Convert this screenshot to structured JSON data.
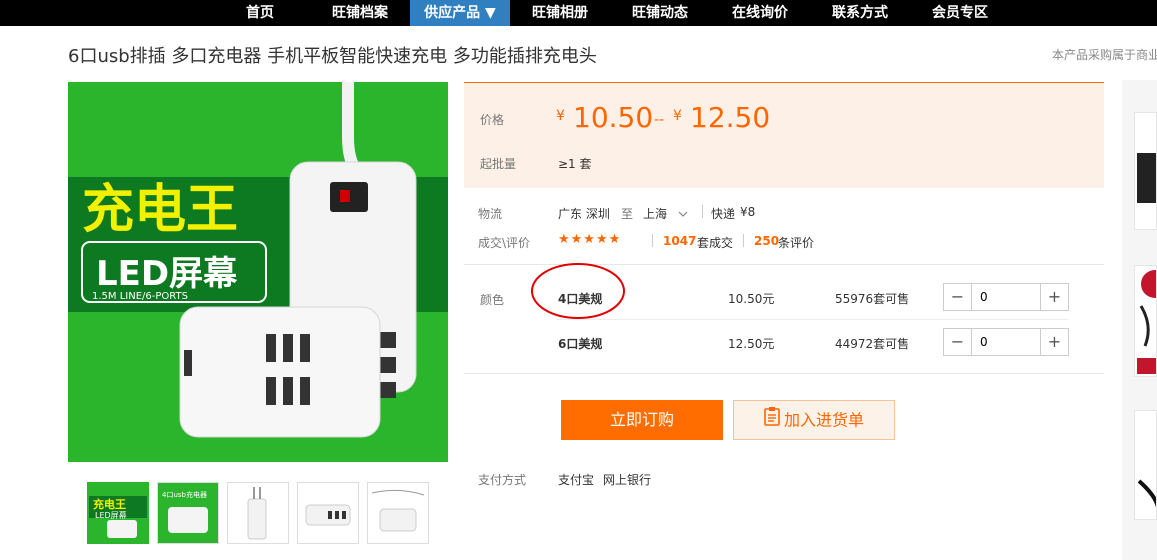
{
  "nav": {
    "items": [
      "首页",
      "旺铺档案",
      "供应产品 ▼",
      "旺铺相册",
      "旺铺动态",
      "在线询价",
      "联系方式",
      "会员专区"
    ]
  },
  "product": {
    "title": "6口usb排插 多口充电器 手机平板智能快速充电 多功能插排充电头",
    "right_note": "本产品采购属于商业",
    "image_text": {
      "headline": "充电王",
      "subline": "LED屏幕",
      "spec": "1.5M LINE/6-PORTS"
    },
    "thumb_texts": [
      "充电王",
      "LED屏幕",
      "4口usb充电器"
    ]
  },
  "price": {
    "label": "价格",
    "currency": "¥",
    "min": "10.50",
    "dash": "--",
    "max": "12.50",
    "moq_label": "起批量",
    "moq_value": "≥1 套"
  },
  "logistics": {
    "label": "物流",
    "from": "广东 深圳",
    "to_word": "至",
    "dest": "上海",
    "method": "快递",
    "fee": "¥8"
  },
  "reviews": {
    "label": "成交\\评价",
    "stars": "★★★★★",
    "deals_count": "1047",
    "deals_text": "套成交",
    "review_count": "250",
    "review_text": "条评价"
  },
  "variants": {
    "label": "颜色",
    "rows": [
      {
        "name": "4口美规",
        "price": "10.50元",
        "stock": "55976套可售",
        "qty": "0"
      },
      {
        "name": "6口美规",
        "price": "12.50元",
        "stock": "44972套可售",
        "qty": "0"
      }
    ]
  },
  "actions": {
    "buy_label": "立即订购",
    "cart_label": "加入进货单"
  },
  "payment": {
    "label": "支付方式",
    "methods": [
      "支付宝",
      "网上银行"
    ]
  },
  "colors": {
    "accent": "#ff6d00",
    "nav_active": "#2f7fc1",
    "image_bg": "#2bb52c",
    "annotation": "#e00000"
  }
}
